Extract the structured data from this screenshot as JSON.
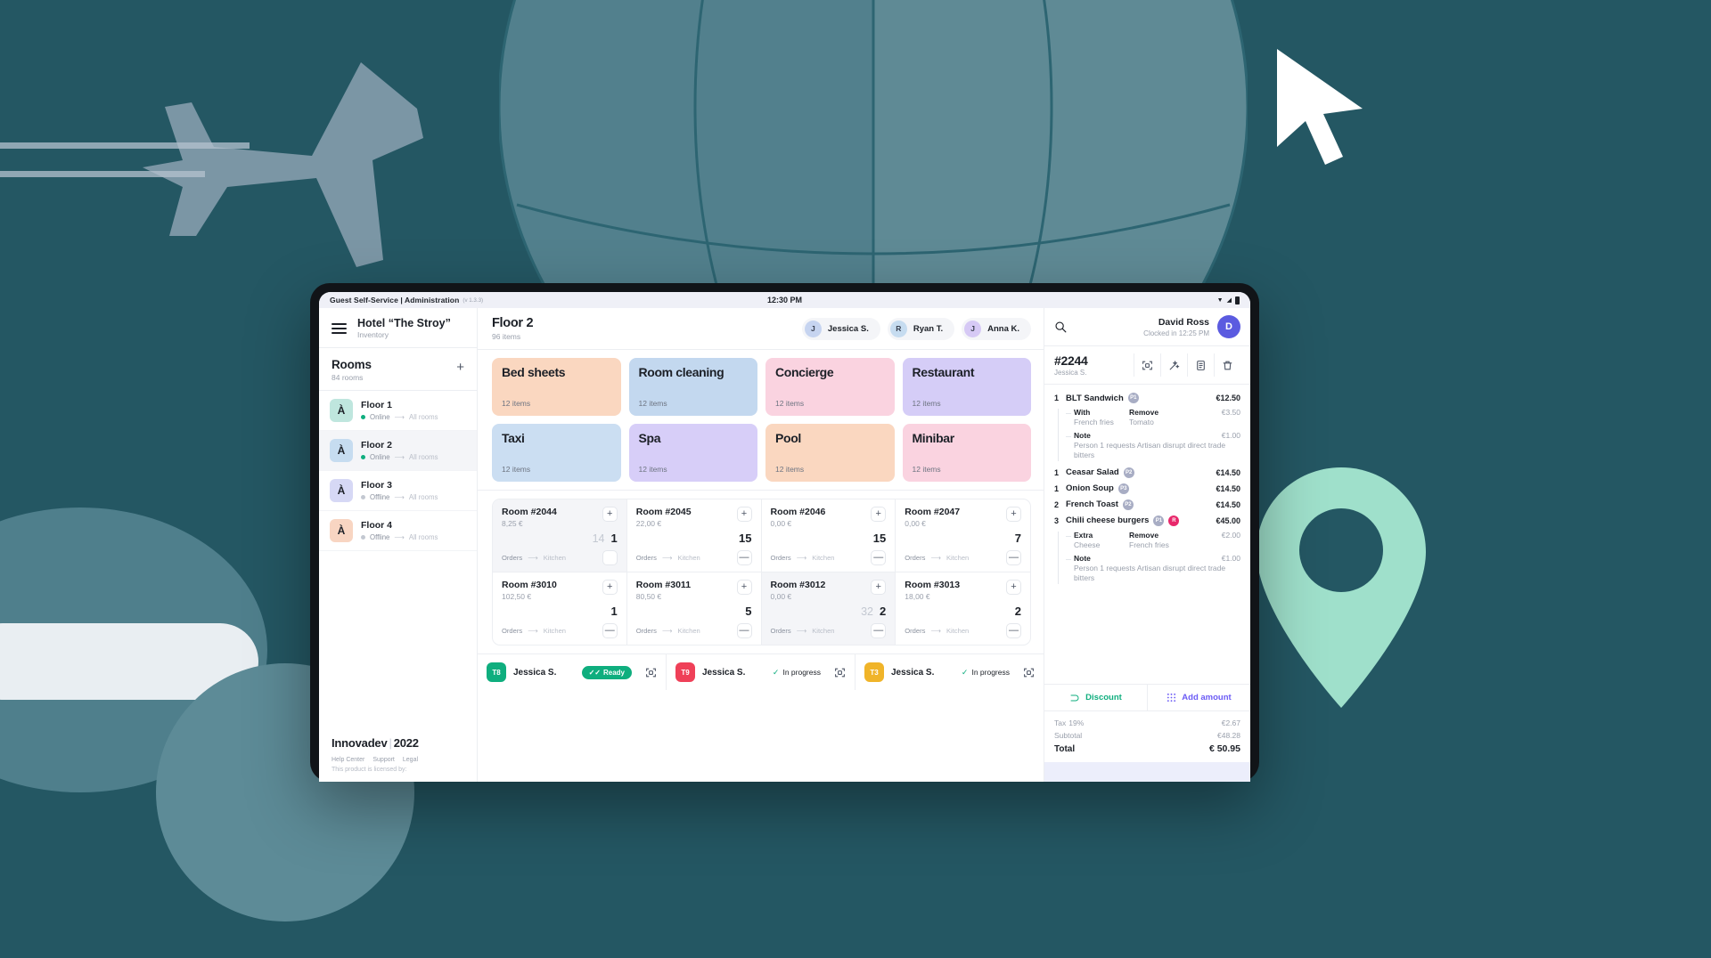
{
  "os": {
    "app_title": "Guest Self-Service | Administration",
    "version": "(v 1.3.3)",
    "clock": "12:30 PM"
  },
  "sidebar": {
    "hotel": "Hotel “The Stroy”",
    "hotel_sub": "Inventory",
    "rooms_title": "Rooms",
    "rooms_count": "84 rooms",
    "add_label": "+",
    "floors": [
      {
        "initial": "À",
        "name": "Floor 1",
        "status": "Online",
        "rooms": "All rooms",
        "color": "#bfe6de",
        "dot": "#0fae7e",
        "active": false
      },
      {
        "initial": "À",
        "name": "Floor 2",
        "status": "Online",
        "rooms": "All rooms",
        "color": "#c6dcf0",
        "dot": "#0fae7e",
        "active": true
      },
      {
        "initial": "À",
        "name": "Floor 3",
        "status": "Offline",
        "rooms": "All rooms",
        "color": "#d6d8f5",
        "dot": "#c3c8d1",
        "active": false
      },
      {
        "initial": "À",
        "name": "Floor 4",
        "status": "Offline",
        "rooms": "All rooms",
        "color": "#f8d5c2",
        "dot": "#c3c8d1",
        "active": false
      }
    ],
    "brand": "Innovadev",
    "brand_year": "2022",
    "links": [
      "Help Center",
      "Support",
      "Legal"
    ],
    "license": "This product is licensed by:"
  },
  "main": {
    "title": "Floor 2",
    "subtitle": "96 items",
    "staff": [
      {
        "initial": "J",
        "name": "Jessica S.",
        "color": "#c6d4f0"
      },
      {
        "initial": "R",
        "name": "Ryan T.",
        "color": "#c6dcf0"
      },
      {
        "initial": "J",
        "name": "Anna K.",
        "color": "#d6c9f5"
      }
    ],
    "categories": [
      {
        "title": "Bed sheets",
        "count": "12 items",
        "color": "#fad7c0"
      },
      {
        "title": "Room cleaning",
        "count": "12 items",
        "color": "#c3d8ef"
      },
      {
        "title": "Concierge",
        "count": "12 items",
        "color": "#fad3e0"
      },
      {
        "title": "Restaurant",
        "count": "12 items",
        "color": "#d5cdf7"
      },
      {
        "title": "Taxi",
        "count": "12 items",
        "color": "#cbdef2"
      },
      {
        "title": "Spa",
        "count": "12 items",
        "color": "#d7cef8"
      },
      {
        "title": "Pool",
        "count": "12 items",
        "color": "#fad7c0"
      },
      {
        "title": "Minibar",
        "count": "12 items",
        "color": "#fad3e0"
      }
    ],
    "orders_label": "Orders",
    "kitchen_label": "Kitchen",
    "rooms": [
      {
        "name": "Room #2044",
        "price": "8,25 €",
        "old": "14",
        "qty": "1",
        "selected": true,
        "box": ""
      },
      {
        "name": "Room #2045",
        "price": "22,00 €",
        "old": "",
        "qty": "15",
        "selected": false,
        "box": "—"
      },
      {
        "name": "Room #2046",
        "price": "0,00 €",
        "old": "",
        "qty": "15",
        "selected": false,
        "box": "—"
      },
      {
        "name": "Room #2047",
        "price": "0,00 €",
        "old": "",
        "qty": "7",
        "selected": false,
        "box": "—"
      },
      {
        "name": "Room #3010",
        "price": "102,50 €",
        "old": "",
        "qty": "1",
        "selected": false,
        "box": "—"
      },
      {
        "name": "Room #3011",
        "price": "80,50 €",
        "old": "",
        "qty": "5",
        "selected": false,
        "box": "—"
      },
      {
        "name": "Room #3012",
        "price": "0,00 €",
        "old": "32",
        "qty": "2",
        "selected": true,
        "box": "—"
      },
      {
        "name": "Room #3013",
        "price": "18,00 €",
        "old": "",
        "qty": "2",
        "selected": false,
        "box": "—"
      }
    ],
    "tasks": [
      {
        "code": "T8",
        "color": "#0fae7e",
        "name": "Jessica S.",
        "status": "Ready",
        "type": "ready"
      },
      {
        "code": "T9",
        "color": "#ef4058",
        "name": "Jessica S.",
        "status": "In progress",
        "type": "progress"
      },
      {
        "code": "T3",
        "color": "#f0b429",
        "name": "Jessica S.",
        "status": "In progress",
        "type": "progress"
      }
    ]
  },
  "order": {
    "user_name": "David Ross",
    "user_clock": "Clocked in 12:25 PM",
    "user_initial": "D",
    "id": "#2244",
    "by": "Jessica S.",
    "items": [
      {
        "qty": "1",
        "name": "BLT Sandwich",
        "price": "€12.50",
        "persons": [
          {
            "label": "P1",
            "color": "#a8adc4"
          }
        ],
        "mods": [
          {
            "k1": "With",
            "k2": "Remove",
            "v1": "French fries",
            "v2": "Tomato",
            "price": "€3.50"
          }
        ],
        "note": {
          "label": "Note",
          "price": "€1.00",
          "text": "Person 1 requests Artisan disrupt direct trade bitters"
        }
      },
      {
        "qty": "1",
        "name": "Ceasar Salad",
        "price": "€14.50",
        "persons": [
          {
            "label": "P2",
            "color": "#a8adc4"
          }
        ],
        "mods": [],
        "note": null
      },
      {
        "qty": "1",
        "name": "Onion Soup",
        "price": "€14.50",
        "persons": [
          {
            "label": "P3",
            "color": "#a8adc4"
          }
        ],
        "mods": [],
        "note": null
      },
      {
        "qty": "2",
        "name": "French Toast",
        "price": "€14.50",
        "persons": [
          {
            "label": "P2",
            "color": "#a8adc4"
          }
        ],
        "mods": [],
        "note": null
      },
      {
        "qty": "3",
        "name": "Chili cheese burgers",
        "price": "€45.00",
        "persons": [
          {
            "label": "P1",
            "color": "#a8adc4"
          },
          {
            "label": "R",
            "color": "#e8286b"
          }
        ],
        "mods": [
          {
            "k1": "Extra",
            "k2": "Remove",
            "v1": "Cheese",
            "v2": "French fries",
            "price": "€2.00"
          }
        ],
        "note": {
          "label": "Note",
          "price": "€1.00",
          "text": "Person 1 requests Artisan disrupt direct trade bitters"
        }
      }
    ],
    "discount_label": "Discount",
    "add_amount_label": "Add amount",
    "totals": [
      {
        "label": "Tax",
        "extra": "19%",
        "value": "€2.67",
        "grand": false
      },
      {
        "label": "Subtotal",
        "extra": "",
        "value": "€48.28",
        "grand": false
      },
      {
        "label": "Total",
        "extra": "",
        "value": "€ 50.95",
        "grand": true
      }
    ]
  }
}
